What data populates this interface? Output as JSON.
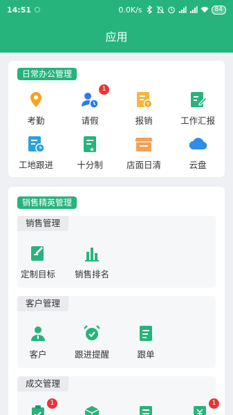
{
  "status": {
    "time": "14:51",
    "speed": "0.0K/s",
    "battery": "84"
  },
  "header": {
    "title": "应用"
  },
  "office": {
    "tag": "日常办公管理",
    "items": [
      {
        "label": "考勤",
        "icon": "location-pin-icon",
        "color": "#f5a524"
      },
      {
        "label": "请假",
        "icon": "user-clock-icon",
        "color": "#2d7de0",
        "badge": "1"
      },
      {
        "label": "报销",
        "icon": "expense-receipt-icon",
        "color": "#f5b73b"
      },
      {
        "label": "工作汇报",
        "icon": "report-edit-icon",
        "color": "#26b47c"
      },
      {
        "label": "工地跟进",
        "icon": "site-followup-icon",
        "color": "#2aa3d8"
      },
      {
        "label": "十分制",
        "icon": "ten-point-doc-icon",
        "color": "#26b47c"
      },
      {
        "label": "店面日清",
        "icon": "storefront-icon",
        "color": "#f0a257"
      },
      {
        "label": "云盘",
        "icon": "cloud-icon",
        "color": "#2d8de8"
      }
    ]
  },
  "sales": {
    "tag": "销售精英管理",
    "sections": [
      {
        "title": "销售管理",
        "items": [
          {
            "label": "定制目标",
            "icon": "target-edit-icon",
            "color": "#26b47c"
          },
          {
            "label": "销售排名",
            "icon": "ranking-bar-icon",
            "color": "#26b47c"
          }
        ]
      },
      {
        "title": "客户管理",
        "items": [
          {
            "label": "客户",
            "icon": "customer-icon",
            "color": "#26b47c"
          },
          {
            "label": "跟进提醒",
            "icon": "alarm-clock-icon",
            "color": "#26b47c"
          },
          {
            "label": "跟单",
            "icon": "order-doc-icon",
            "color": "#26b47c"
          }
        ]
      },
      {
        "title": "成交管理",
        "items": [
          {
            "icon": "clipboard-icon",
            "color": "#26b47c",
            "badge": "1"
          },
          {
            "icon": "box-icon",
            "color": "#26b47c"
          },
          {
            "icon": "list-doc-icon",
            "color": "#26b47c"
          },
          {
            "icon": "yuan-doc-icon",
            "color": "#26b47c",
            "badge": "1"
          }
        ]
      }
    ]
  }
}
